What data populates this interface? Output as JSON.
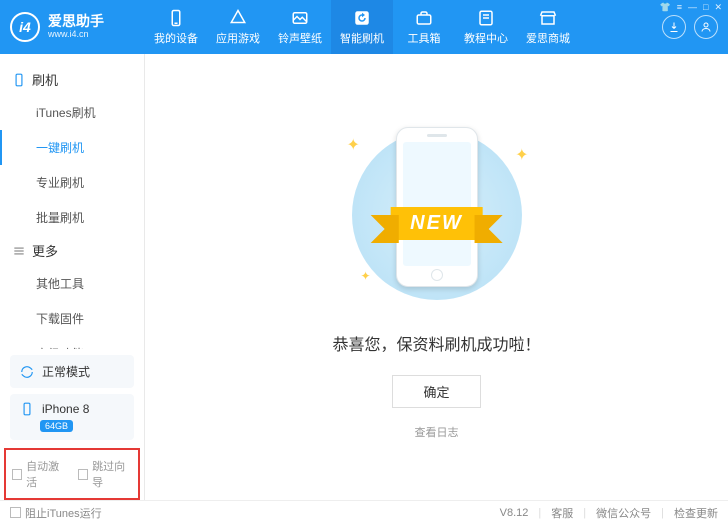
{
  "app": {
    "name": "爱思助手",
    "url": "www.i4.cn",
    "logo_text": "i4"
  },
  "win_controls": [
    "👕",
    "≡",
    "—",
    "□",
    "✕"
  ],
  "top_nav": [
    {
      "label": "我的设备"
    },
    {
      "label": "应用游戏"
    },
    {
      "label": "铃声壁纸"
    },
    {
      "label": "智能刷机",
      "active": true
    },
    {
      "label": "工具箱"
    },
    {
      "label": "教程中心"
    },
    {
      "label": "爱思商城"
    }
  ],
  "sidebar": {
    "section1": {
      "title": "刷机",
      "items": [
        "iTunes刷机",
        "一键刷机",
        "专业刷机",
        "批量刷机"
      ],
      "active_index": 1
    },
    "section2": {
      "title": "更多",
      "items": [
        "其他工具",
        "下载固件",
        "高级功能"
      ]
    },
    "mode": "正常模式",
    "device": {
      "name": "iPhone 8",
      "storage": "64GB"
    },
    "checkboxes": {
      "auto_activate": "自动激活",
      "skip_guide": "跳过向导"
    }
  },
  "main": {
    "ribbon": "NEW",
    "message": "恭喜您，保资料刷机成功啦！",
    "ok": "确定",
    "view_log": "查看日志"
  },
  "footer": {
    "block_itunes": "阻止iTunes运行",
    "version": "V8.12",
    "support": "客服",
    "wechat": "微信公众号",
    "update": "检查更新"
  }
}
